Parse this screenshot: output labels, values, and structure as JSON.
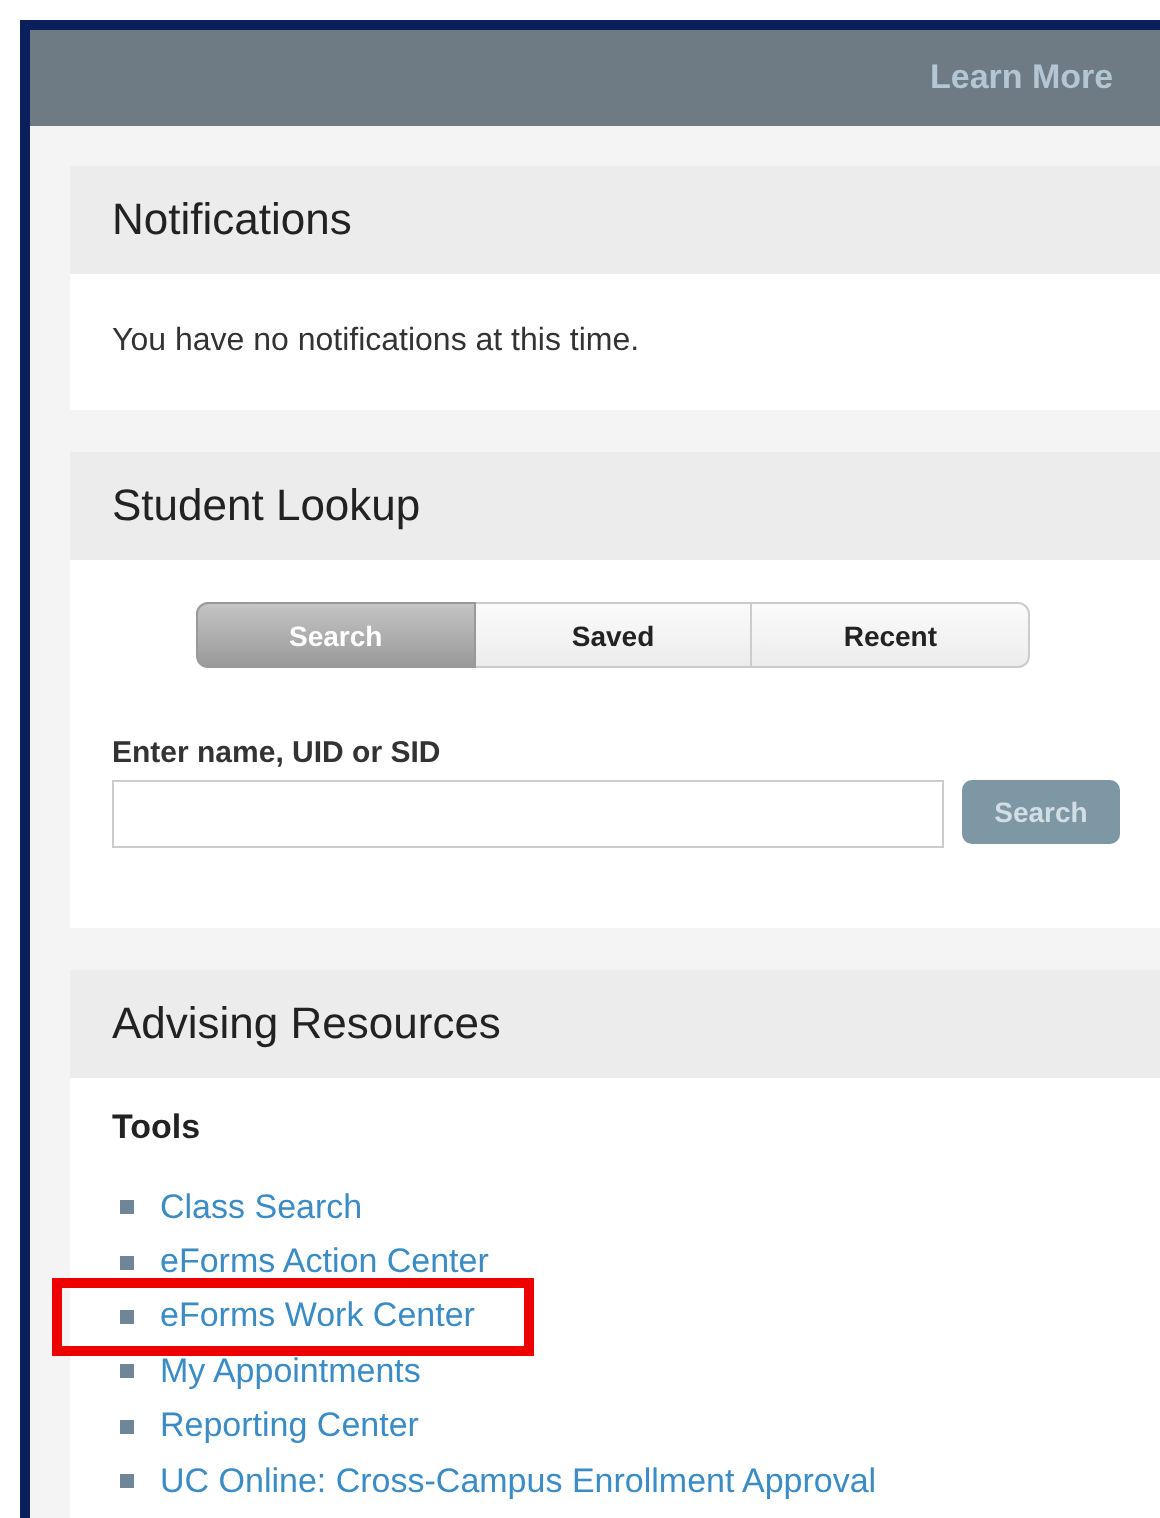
{
  "header": {
    "link": "Learn More"
  },
  "notifications": {
    "title": "Notifications",
    "message": "You have no notifications at this time."
  },
  "student_lookup": {
    "title": "Student Lookup",
    "tabs": [
      {
        "label": "Search",
        "selected": true
      },
      {
        "label": "Saved",
        "selected": false
      },
      {
        "label": "Recent",
        "selected": false
      }
    ],
    "field_label": "Enter name, UID or SID",
    "search_button": {
      "label": "Search",
      "disabled": true
    }
  },
  "advising_resources": {
    "title": "Advising Resources",
    "section": "Tools",
    "links": [
      {
        "label": "Class Search",
        "highlighted": false
      },
      {
        "label": "eForms Action Center",
        "highlighted": false
      },
      {
        "label": "eForms Work Center",
        "highlighted": true
      },
      {
        "label": "My Appointments",
        "highlighted": false
      },
      {
        "label": "Reporting Center",
        "highlighted": false
      },
      {
        "label": "UC Online: Cross-Campus Enrollment Approval",
        "highlighted": false
      }
    ]
  }
}
